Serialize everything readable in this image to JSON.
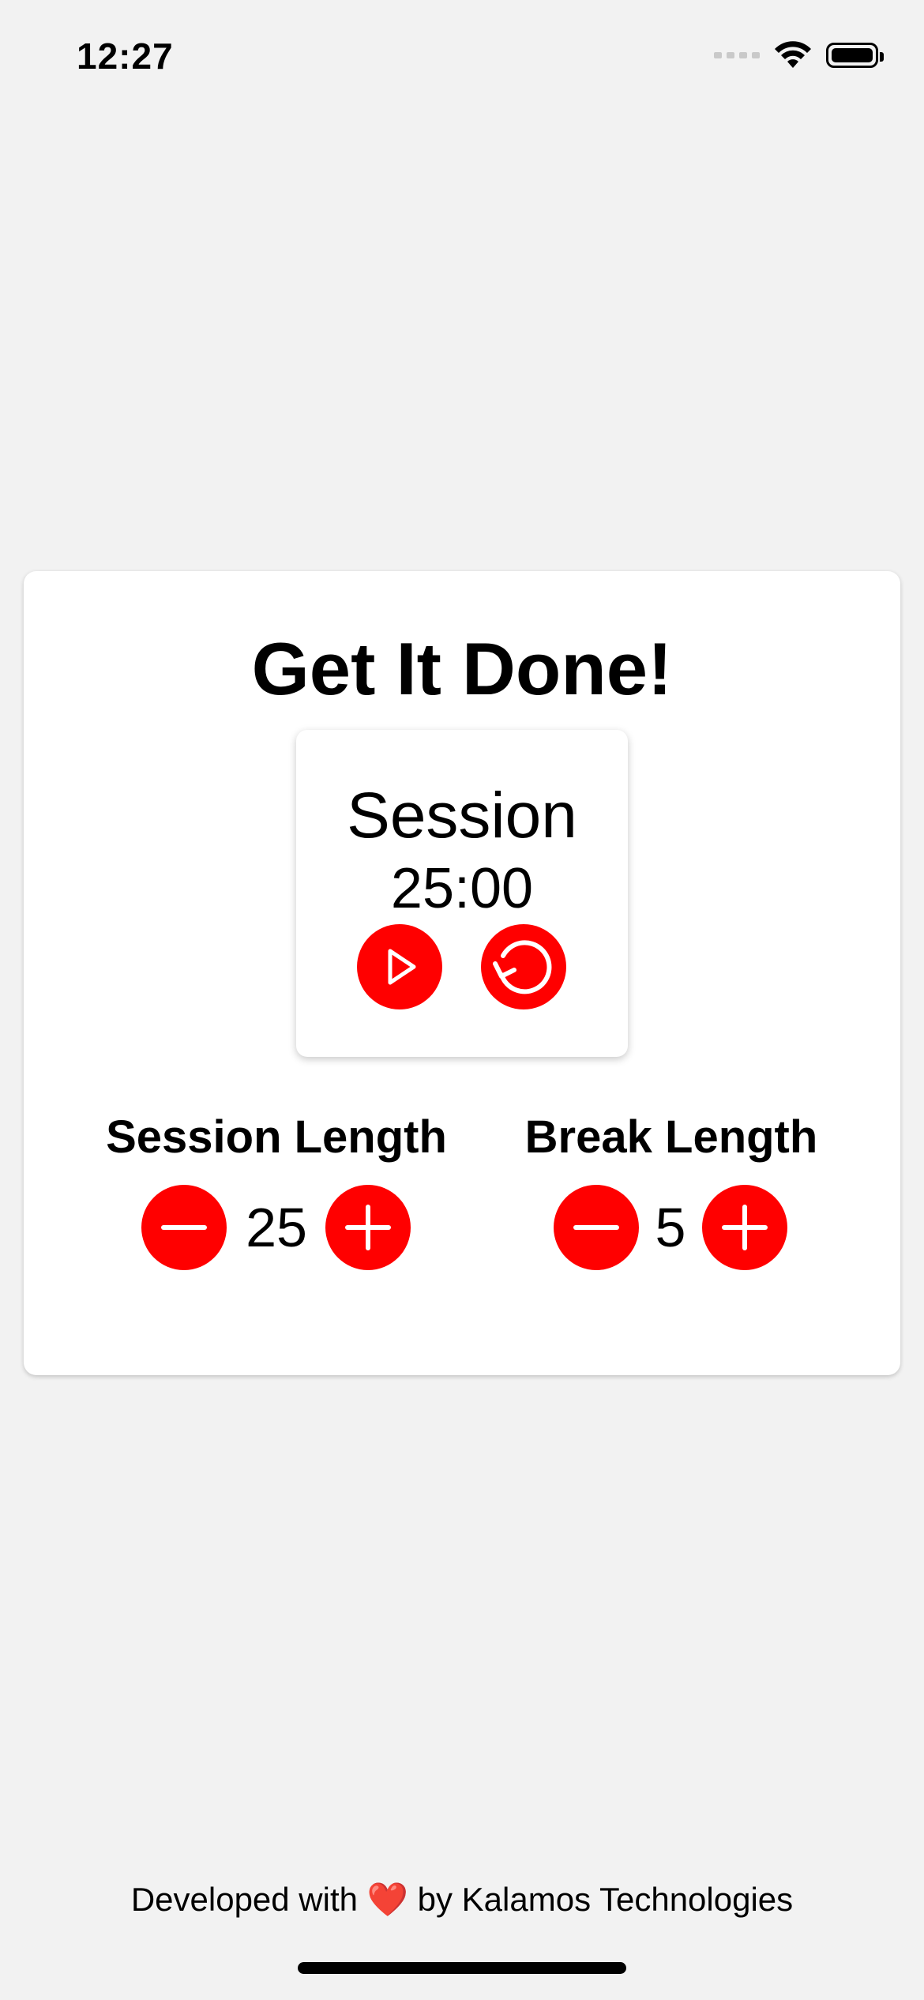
{
  "status_bar": {
    "time": "12:27",
    "icons": [
      "cellular-signal-icon",
      "wifi-icon",
      "battery-icon"
    ]
  },
  "app": {
    "title": "Get It Done!",
    "accent_color": "#ff0000",
    "timer": {
      "label": "Session",
      "time": "25:00",
      "play_icon": "play-icon",
      "reset_icon": "reset-icon"
    },
    "session_length": {
      "label": "Session Length",
      "value": "25"
    },
    "break_length": {
      "label": "Break Length",
      "value": "5"
    }
  },
  "footer": {
    "prefix": "Developed with",
    "heart": "❤️",
    "suffix": "by Kalamos Technologies"
  }
}
